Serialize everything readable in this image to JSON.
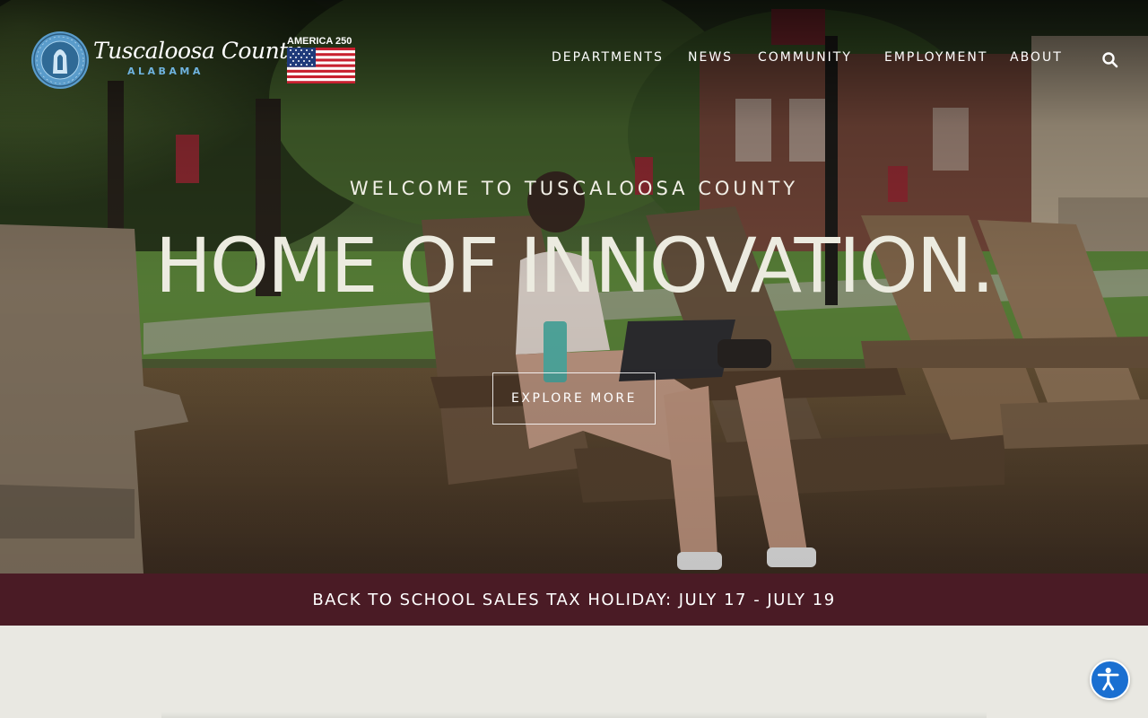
{
  "header": {
    "brand_name": "Tuscaloosa County",
    "brand_state": "ALABAMA",
    "america_badge": "AMERICA 250"
  },
  "nav": {
    "items": [
      "DEPARTMENTS",
      "NEWS",
      "COMMUNITY",
      "EMPLOYMENT",
      "ABOUT"
    ],
    "search_icon": "search-icon"
  },
  "hero": {
    "welcome": "WELCOME TO TUSCALOOSA COUNTY",
    "headline": "HOME OF INNOVATION.",
    "cta_label": "EXPLORE MORE"
  },
  "banner": {
    "text": "BACK TO SCHOOL SALES TAX HOLIDAY: JULY 17 - JULY 19"
  },
  "accessibility": {
    "icon": "accessibility-icon"
  },
  "colors": {
    "banner_bg": "#4a1b25",
    "state_text": "#6fb3df",
    "a11y_button": "#1a6fd1",
    "page_bg": "#e9e8e2"
  }
}
